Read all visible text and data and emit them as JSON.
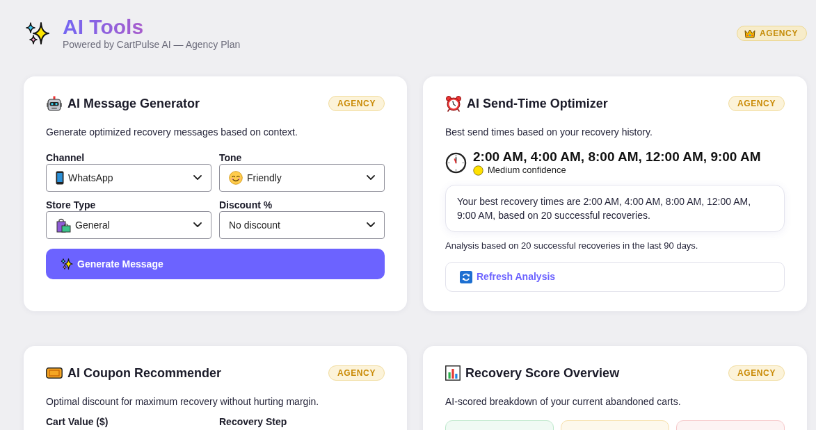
{
  "header": {
    "title": "AI Tools",
    "subtitle": "Powered by CartPulse AI — Agency Plan",
    "plan_badge": "AGENCY"
  },
  "cards": [
    {
      "kind": "generator",
      "title": "AI Message Generator",
      "badge": "AGENCY",
      "description": "Generate optimized recovery messages based on context.",
      "fields": [
        {
          "label": "Channel",
          "value": "WhatsApp"
        },
        {
          "label": "Tone",
          "value": "Friendly"
        },
        {
          "label": "Store Type",
          "value": "General"
        },
        {
          "label": "Discount %",
          "value": "No discount"
        }
      ],
      "button": "Generate Message"
    },
    {
      "kind": "send_time",
      "title": "AI Send-Time Optimizer",
      "badge": "AGENCY",
      "description": "Best send times based on your recovery history.",
      "best_times": "2:00 AM, 4:00 AM, 8:00 AM, 12:00 AM, 9:00 AM",
      "confidence": "Medium confidence",
      "summary": "Your best recovery times are 2:00 AM, 4:00 AM, 8:00 AM, 12:00 AM, 9:00 AM, based on 20 successful recoveries.",
      "note": "Analysis based on 20 successful recoveries in the last 90 days.",
      "button": "Refresh Analysis"
    },
    {
      "kind": "coupon",
      "title": "AI Coupon Recommender",
      "badge": "AGENCY",
      "description": "Optimal discount for maximum recovery without hurting margin.",
      "fields": [
        {
          "label": "Cart Value ($)"
        },
        {
          "label": "Recovery Step"
        }
      ]
    },
    {
      "kind": "score",
      "title": "Recovery Score Overview",
      "badge": "AGENCY",
      "description": "AI-scored breakdown of your current abandoned carts.",
      "tiles": [
        {
          "color": "#bde8cb"
        },
        {
          "color": "#f6dfa9"
        },
        {
          "color": "#f6c7c9"
        }
      ]
    }
  ]
}
